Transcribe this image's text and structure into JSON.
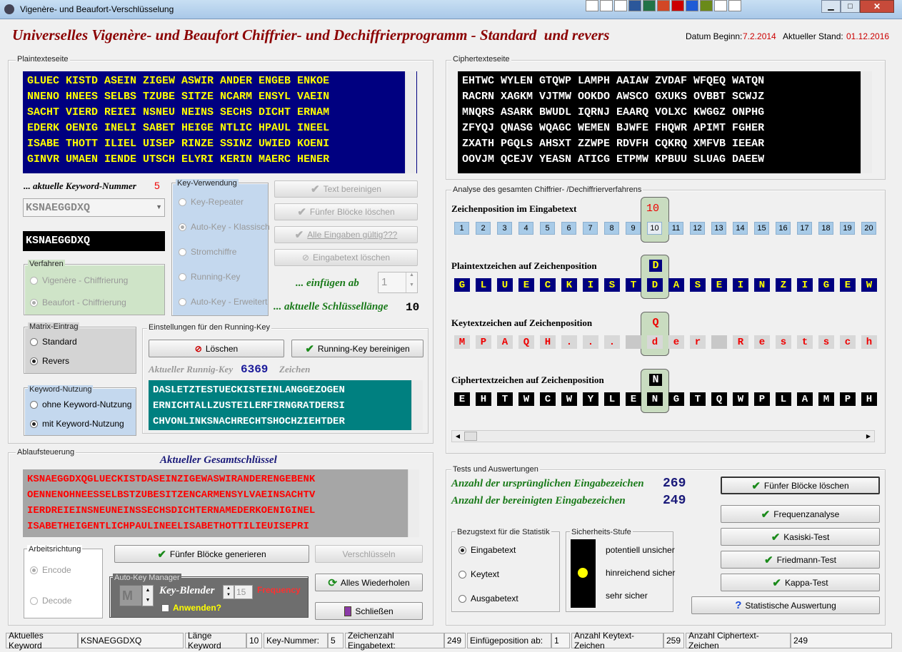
{
  "window": {
    "title": "Vigenère- und Beaufort-Verschlüsselung"
  },
  "header": {
    "title": "Universelles Vigenère- und Beaufort Chiffrier- und Dechiffrierprogramm - Standard  und revers",
    "date_begin_label": "Datum Beginn:",
    "date_begin": "7.2.2014",
    "status_label": "Aktueller Stand:",
    "status_date": "01.12.2016"
  },
  "plain": {
    "legend": "Plaintexteseite",
    "lines": [
      "GLUEC KISTD ASEIN ZIGEW ASWIR ANDER ENGEB ENKOE",
      "NNENO HNEES SELBS TZUBE SITZE NCARM ENSYL VAEIN",
      "SACHT VIERD REIEI NSNEU NEINS SECHS DICHT ERNAM",
      "EDERK OENIG INELI SABET HEIGE NTLIC HPAUL INEEL",
      "ISABE THOTT ILIEL UISEP RINZE SSINZ UWIED KOENI",
      "GINVR UMAEN IENDE UTSCH ELYRI KERIN MAERC HENER"
    ]
  },
  "cipher": {
    "legend": "Ciphertexteseite",
    "lines": [
      "EHTWC WYLEN GTQWP LAMPH AAIAW ZVDAF WFQEQ WATQN",
      "RACRN XAGKM VJTMW OOKDO AWSCO GXUKS OVBBT SCWJZ",
      "MNQRS ASARK BWUDL IQRNJ EAARQ VOLXC KWGGZ ONPHG",
      "ZFYQJ QNASG WQAGC WEMEN BJWFE FHQWR APIMT FGHER",
      "ZXATH PGQLS AHSXT ZZWPE RDVFH CQKRQ XMFVB IEEAR",
      "OOVJM QCEJV YEASN ATICG ETPMW KPBUU SLUAG DAEEW"
    ]
  },
  "keyword": {
    "label": "... aktuelle Keyword-Nummer",
    "number": "5",
    "combo": "KSNAEGGDXQ",
    "display": "KSNAEGGDXQ"
  },
  "keyverw": {
    "legend": "Key-Verwendung",
    "options": [
      "Key-Repeater",
      "Auto-Key - Klassisch",
      "Stromchiffre",
      "Running-Key",
      "Auto-Key - Erweitert"
    ]
  },
  "verfahren": {
    "legend": "Verfahren",
    "options": [
      "Vigenère - Chiffrierung",
      "Beaufort - Chiffrierung"
    ]
  },
  "buttons": {
    "text_bereinigen": "Text bereinigen",
    "fuenfer_loeschen": "Fünfer Blöcke löschen",
    "alle_gueltig": "Alle Eingaben gültig???",
    "eingabe_loeschen": "Eingabetext löschen",
    "loeschen": "Löschen",
    "running_bereinigen": "Running-Key bereinigen",
    "fuenfer_generieren": "Fünfer Blöcke generieren",
    "verschluesseln": "Verschlüsseln",
    "wiederholen": "Alles Wiederholen",
    "schliessen": "Schließen",
    "fuenfer_loeschen2": "Fünfer Blöcke löschen",
    "frequenz": "Frequenzanalyse",
    "kasiski": "Kasiski-Test",
    "friedmann": "Friedmann-Test",
    "kappa": "Kappa-Test",
    "statistik": "Statistische Auswertung"
  },
  "einfuegen": {
    "label": "... einfügen ab",
    "value": "1",
    "len_label": "... aktuelle Schlüssellänge",
    "len": "10"
  },
  "matrix": {
    "legend": "Matrix-Eintrag",
    "options": [
      "Standard",
      "Revers"
    ]
  },
  "kwnutz": {
    "legend": "Keyword-Nutzung",
    "options": [
      "ohne Keyword-Nutzung",
      "mit Keyword-Nutzung"
    ]
  },
  "running": {
    "legend": "Einstellungen für den Running-Key",
    "label": "Aktueller Runnig-Key",
    "count": "6369",
    "unit": "Zeichen",
    "lines": [
      "DASLETZTESTUECKISTEINLANGGEZOGEN",
      "ERNICHTALLZUSTEILERFIRNGRATDERSI",
      "CHVONLINKSNACHRECHTSHOCHZIEHTDER"
    ]
  },
  "ablauf": {
    "legend": "Ablaufsteuerung",
    "title": "Aktueller Gesamtschlüssel",
    "lines": [
      "KSNAEGGDXQGLUECKISTDASEINZIGEWASWIRANDERENGEBENK",
      "OENNENOHNEESSELBSTZUBESITZENCARMENSYLVAEINSACHTV",
      "IERDREIEINSNEUNEINSSECHSDICHTERNAMEDERKOENIGINEL",
      "ISABETHEIGENTLICHPAULINEELISABETHOTTILIEUISEPRI"
    ]
  },
  "arbeit": {
    "legend": "Arbeitsrichtung",
    "options": [
      "Encode",
      "Decode"
    ]
  },
  "autokey": {
    "legend": "Auto-Key Manager",
    "m": "M",
    "blender": "Key-Blender",
    "val": "15",
    "freq": "Frequency",
    "apply": "Anwenden?"
  },
  "analyse": {
    "legend": "Analyse des gesamten Chiffrier- /Dechiffrierverfahrens",
    "pos_label": "Zeichenposition im Eingabetext",
    "pos_current": "10",
    "positions": [
      "1",
      "2",
      "3",
      "4",
      "5",
      "6",
      "7",
      "8",
      "9",
      "10",
      "11",
      "12",
      "13",
      "14",
      "15",
      "16",
      "17",
      "18",
      "19",
      "20"
    ],
    "plain_label": "Plaintextzeichen auf Zeichenposition",
    "plain_current": "D",
    "plain": [
      "G",
      "L",
      "U",
      "E",
      "C",
      "K",
      "I",
      "S",
      "T",
      "D",
      "A",
      "S",
      "E",
      "I",
      "N",
      "Z",
      "I",
      "G",
      "E",
      "W"
    ],
    "key_label": "Keytextzeichen auf Zeichenposition",
    "key_current": "Q",
    "key": [
      "M",
      "P",
      "A",
      "Q",
      "H",
      ".",
      ".",
      ".",
      "",
      "d",
      "e",
      "r",
      "",
      "R",
      "e",
      "s",
      "t",
      "s",
      "c",
      "h"
    ],
    "cipher_label": "Ciphertextzeichen auf Zeichenposition",
    "cipher_current": "N",
    "cipher": [
      "E",
      "H",
      "T",
      "W",
      "C",
      "W",
      "Y",
      "L",
      "E",
      "N",
      "G",
      "T",
      "Q",
      "W",
      "P",
      "L",
      "A",
      "M",
      "P",
      "H"
    ]
  },
  "tests": {
    "legend": "Tests und Auswertungen",
    "orig_label": "Anzahl der ursprünglichen Eingabezeichen",
    "orig": "269",
    "clean_label": "Anzahl der bereinigten Eingabezeichen",
    "clean": "249"
  },
  "bezug": {
    "legend": "Bezugstext für die Statistik",
    "options": [
      "Eingabetext",
      "Keytext",
      "Ausgabetext"
    ]
  },
  "sicher": {
    "legend": "Sicherheits-Stufe",
    "levels": [
      "potentiell unsicher",
      "hinreichend sicher",
      "sehr sicher"
    ]
  },
  "statusbar": {
    "kw_label": "Aktuelles Keyword",
    "kw": "KSNAEGGDXQ",
    "len_label": "Länge Keyword",
    "len": "10",
    "nr_label": "Key-Nummer:",
    "nr": "5",
    "cnt_label": "Zeichenzahl Eingabetext:",
    "cnt": "249",
    "ins_label": "Einfügeposition ab:",
    "ins": "1",
    "kt_label": "Anzahl Keytext-Zeichen",
    "kt": "259",
    "ct_label": "Anzahl Ciphertext-Zeichen",
    "ct": "249"
  },
  "colors": {
    "plain_bg": "#000080",
    "plain_fg": "#ffff00",
    "cipher_bg": "#000000",
    "running_bg": "#008080",
    "key_bg": "#a0a0a0",
    "key_fg": "#ff0000",
    "title": "#8b0000"
  }
}
